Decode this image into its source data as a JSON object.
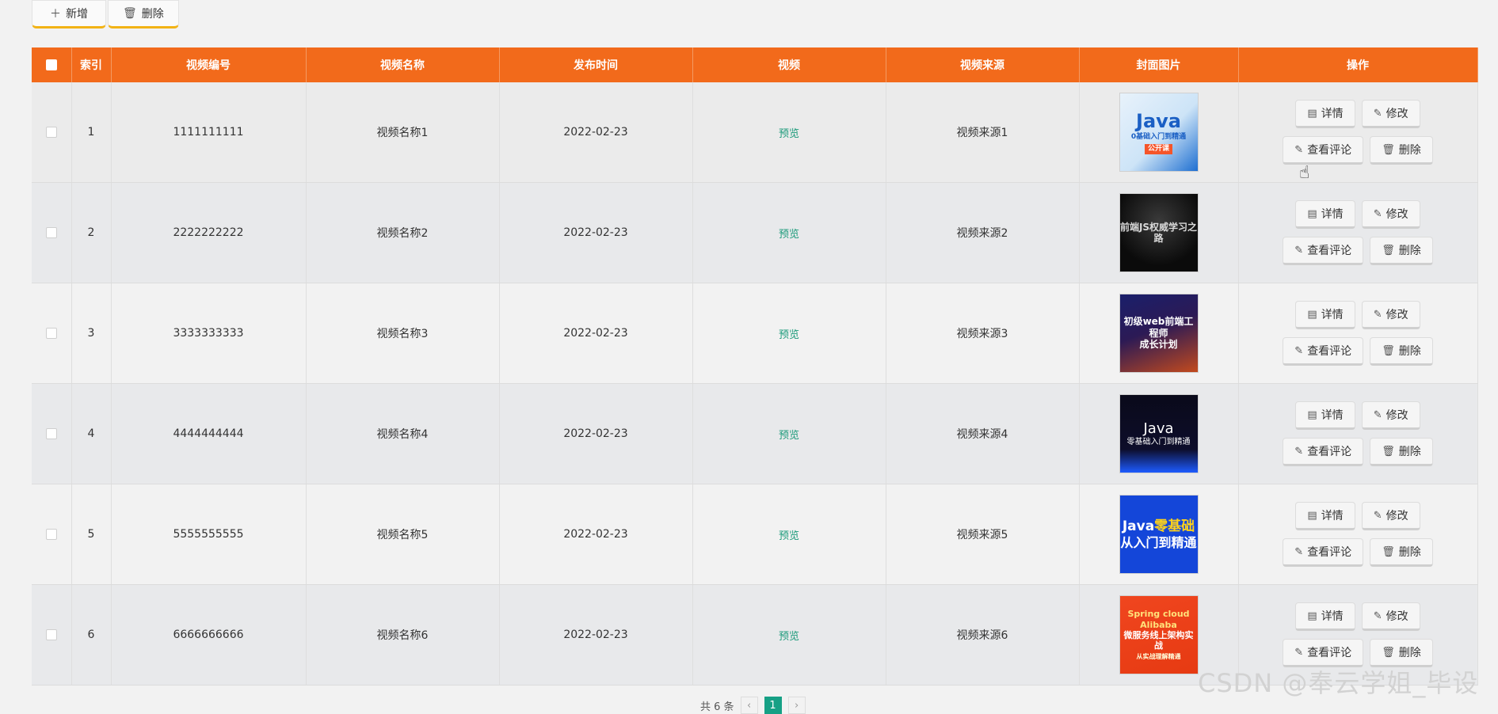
{
  "toolbar": {
    "add_label": "新增",
    "delete_label": "删除"
  },
  "table": {
    "headers": {
      "index": "索引",
      "video_no": "视频编号",
      "video_name": "视频名称",
      "publish_time": "发布时间",
      "video": "视频",
      "source": "视频来源",
      "cover": "封面图片",
      "actions": "操作"
    },
    "rows": [
      {
        "index": "1",
        "video_no": "1111111111",
        "video_name": "视频名称1",
        "publish_time": "2022-02-23",
        "video": "预览",
        "source": "视频来源1"
      },
      {
        "index": "2",
        "video_no": "2222222222",
        "video_name": "视频名称2",
        "publish_time": "2022-02-23",
        "video": "预览",
        "source": "视频来源2"
      },
      {
        "index": "3",
        "video_no": "3333333333",
        "video_name": "视频名称3",
        "publish_time": "2022-02-23",
        "video": "预览",
        "source": "视频来源3"
      },
      {
        "index": "4",
        "video_no": "4444444444",
        "video_name": "视频名称4",
        "publish_time": "2022-02-23",
        "video": "预览",
        "source": "视频来源4"
      },
      {
        "index": "5",
        "video_no": "5555555555",
        "video_name": "视频名称5",
        "publish_time": "2022-02-23",
        "video": "预览",
        "source": "视频来源5"
      },
      {
        "index": "6",
        "video_no": "6666666666",
        "video_name": "视频名称6",
        "publish_time": "2022-02-23",
        "video": "预览",
        "source": "视频来源6"
      }
    ],
    "actions": {
      "detail": "详情",
      "edit": "修改",
      "comments": "查看评论",
      "delete": "删除"
    }
  },
  "covers": [
    {
      "line1": "Java",
      "line2": "0基础入门到精通",
      "line3": "公开课"
    },
    {
      "line1": "前端JS权威学习之路"
    },
    {
      "line1": "初级web前端工程师",
      "line2": "成长计划"
    },
    {
      "line1": "Java",
      "line2": "零基础入门到精通"
    },
    {
      "line1a": "Java",
      "line1b": "零基础",
      "line2": "从入门到精通"
    },
    {
      "line1": "Spring cloud Alibaba",
      "line2": "微服务线上架构实战",
      "line3": "从实战理解精通"
    }
  ],
  "pagination": {
    "total_label": "共 6 条",
    "prev": "‹",
    "current": "1",
    "next": "›"
  },
  "watermark": "CSDN @奉云学姐_毕设",
  "colors": {
    "header_bg": "#f26a1b",
    "preview_link": "#1b9a7a",
    "toolbar_accent": "#f2b315",
    "pager_active": "#16a085"
  }
}
